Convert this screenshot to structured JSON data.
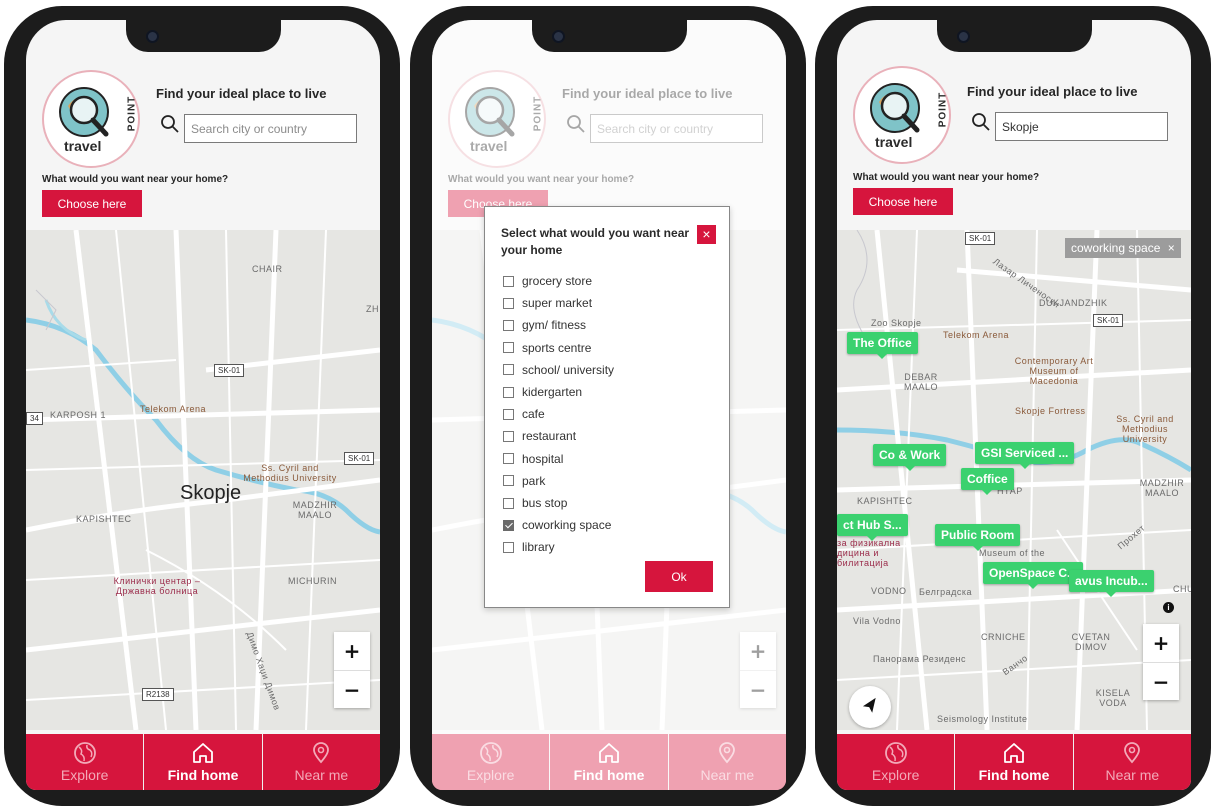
{
  "header": {
    "logo_travel": "travel",
    "logo_point": "POINT",
    "headline": "Find your ideal place to live",
    "search_placeholder": "Search city or country",
    "near_label": "What would you want near your home?",
    "choose_button": "Choose here"
  },
  "nav": {
    "explore": "Explore",
    "find_home": "Find home",
    "near_me": "Near me"
  },
  "map1": {
    "labels": {
      "chair": "CHAIR",
      "zh": "ZH",
      "karposh": "KARPOSH 1",
      "telekom": "Telekom Arena",
      "university": "Ss. Cyril and Methodius University",
      "city": "Skopje",
      "kapishtec": "KAPISHTEC",
      "madzhir": "MADZHIR MAALO",
      "michurin": "MICHURIN",
      "clinic": "Клинички центар – Државна болница",
      "street": "Димо Хаџи Димов"
    },
    "shields": {
      "sk01a": "SK-01",
      "sk01b": "SK-01",
      "r2138": "R2138",
      "n34": "34"
    }
  },
  "modal": {
    "title": "Select what would you want near your home",
    "close": "×",
    "ok": "Ok",
    "options": [
      {
        "label": "grocery store",
        "checked": false
      },
      {
        "label": "super market",
        "checked": false
      },
      {
        "label": "gym/ fitness",
        "checked": false
      },
      {
        "label": "sports centre",
        "checked": false
      },
      {
        "label": "school/ university",
        "checked": false
      },
      {
        "label": "kidergarten",
        "checked": false
      },
      {
        "label": "cafe",
        "checked": false
      },
      {
        "label": "restaurant",
        "checked": false
      },
      {
        "label": "hospital",
        "checked": false
      },
      {
        "label": "park",
        "checked": false
      },
      {
        "label": "bus stop",
        "checked": false
      },
      {
        "label": "coworking space",
        "checked": true
      },
      {
        "label": "library",
        "checked": false
      }
    ]
  },
  "phone3": {
    "search_value": "Skopje",
    "filter_chip": "coworking space",
    "filter_close": "×",
    "markers": {
      "office": "The Office",
      "cowork": "Co & Work",
      "gsi": "GSI Serviced ...",
      "coffice": "Coffice",
      "hub": "ct Hub S...",
      "public": "Public Room",
      "openspace": "OpenSpace C...",
      "incub": "avus Incub..."
    },
    "labels": {
      "zoo": "Zoo Skopje",
      "telekom": "Telekom Arena",
      "dukjandzhik": "DUKJANDZHIK",
      "lazar": "Лазар Личеноски",
      "museum": "Contemporary Art Museum of Macedonia",
      "debar": "DEBAR MAALO",
      "fortress": "Skopje Fortress",
      "university": "Ss. Cyril and Methodius University",
      "madzhir": "MADZHIR MAALO",
      "kapishtec": "KAPISHTEC",
      "centar": "НТАР",
      "museum_city": "Museum of the",
      "rehab": "за физикална дицина и билитација",
      "vodno": "VODNO",
      "belgradska": "Белградска",
      "vila": "Vila Vodno",
      "panorama": "Панорама Резиденс",
      "crniche": "CRNICHE",
      "cvetan": "CVETAN DIMOV",
      "kisela": "KISELA VODA",
      "seismology": "Seismology Institute",
      "chu": "CHU",
      "prohet": "Прохет",
      "vanco": "Ванчо"
    },
    "shields": {
      "sk01a": "SK-01",
      "sk01b": "SK-01"
    }
  },
  "icons": {
    "explore": "globe-icon",
    "find_home": "home-icon",
    "near_me": "map-pin-icon",
    "search": "search-icon",
    "locate": "navigation-arrow-icon"
  },
  "colors": {
    "brand": "#d6153d",
    "marker": "#3bd16f",
    "chip": "#9c9c9c"
  }
}
